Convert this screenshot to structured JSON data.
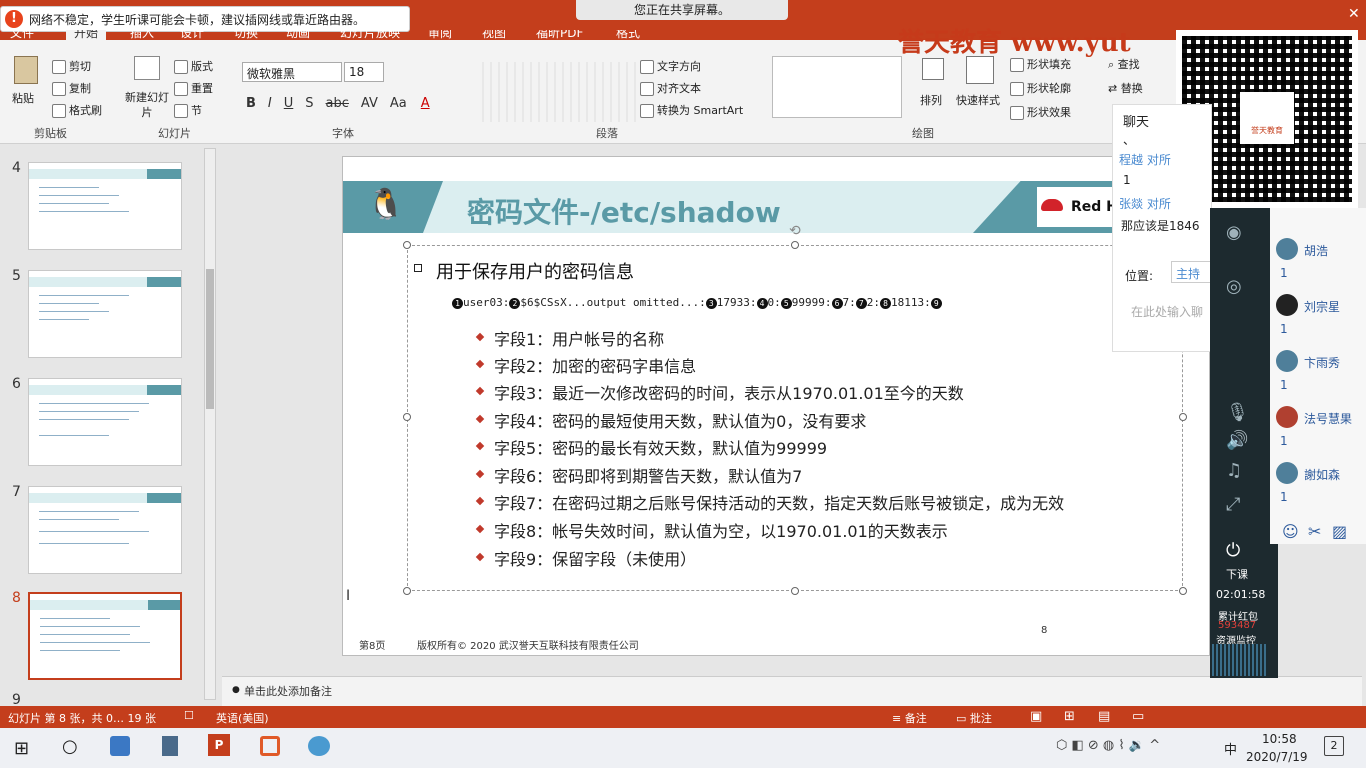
{
  "notification": {
    "text": "网络不稳定，学生听课可能会卡顿，建议插网线或靠近路由器。"
  },
  "share_banner": "您正在共享屏幕。",
  "brand": "誉天教育 www.yut",
  "ribbon": {
    "tabs": [
      "文件",
      "开始",
      "插入",
      "设计",
      "切换",
      "动画",
      "幻灯片放映",
      "审阅",
      "视图",
      "福昕PDF",
      "格式"
    ],
    "clipboard": {
      "paste": "粘贴",
      "cut": "剪切",
      "copy": "复制",
      "format_painter": "格式刷",
      "label": "剪贴板"
    },
    "slides": {
      "new_slide": "新建幻灯片",
      "layout": "版式",
      "reset": "重置",
      "section": "节",
      "label": "幻灯片"
    },
    "font": {
      "name": "微软雅黑",
      "size": "18",
      "label": "字体"
    },
    "paragraph": {
      "text_direction": "文字方向",
      "align_text": "对齐文本",
      "smartart": "转换为 SmartArt",
      "label": "段落"
    },
    "drawing": {
      "arrange": "排列",
      "quick_styles": "快速样式",
      "shape_fill": "形状填充",
      "shape_outline": "形状轮廓",
      "shape_effects": "形状效果",
      "label": "绘图"
    },
    "editing": {
      "find": "查找",
      "replace": "替换"
    }
  },
  "thumbnails": [
    "4",
    "5",
    "6",
    "7",
    "8",
    "9"
  ],
  "slide": {
    "title": "密码文件-/etc/shadow",
    "redhat": "Red H",
    "heading": "用于保存用户的密码信息",
    "sample": {
      "parts": [
        "user03:",
        "$6$CSsX...output omitted...:",
        "17933:",
        "0:",
        "99999:",
        "7:",
        "2:",
        "18113:"
      ],
      "markers": [
        "1",
        "2",
        "3",
        "4",
        "5",
        "6",
        "7",
        "8",
        "9"
      ]
    },
    "fields": [
      "字段1：用户帐号的名称",
      "字段2：加密的密码字串信息",
      "字段3：最近一次修改密码的时间，表示从1970.01.01至今的天数",
      "字段4：密码的最短使用天数，默认值为0，没有要求",
      "字段5：密码的最长有效天数，默认值为99999",
      "字段6：密码即将到期警告天数，默认值为7",
      "字段7：在密码过期之后账号保持活动的天数，指定天数后账号被锁定，成为无效",
      "字段8：帐号失效时间，默认值为空，以1970.01.01的天数表示",
      "字段9：保留字段（未使用）"
    ],
    "footer_page": "第8页",
    "footer_copyright": "版权所有© 2020 武汉誉天互联科技有限责任公司",
    "page_number": "8"
  },
  "notes_placeholder": "单击此处添加备注",
  "status": {
    "slide_info": "幻灯片 第 8 张，共 0… 19 张",
    "language": "英语(美国)",
    "notes": "备注",
    "comments": "批注"
  },
  "chat": {
    "title": "聊天",
    "lines": [
      "、",
      "程越 对所",
      "1",
      "张燚 对所",
      "那应该是1846"
    ],
    "position_label": "位置:",
    "position_value": "主持",
    "input_placeholder": "在此处输入聊"
  },
  "qr_caption": "誉天教育",
  "participants": [
    {
      "name": "胡浩",
      "count": "1"
    },
    {
      "name": "刘宗星",
      "count": "1"
    },
    {
      "name": "卞雨秀",
      "count": "1"
    },
    {
      "name": "法号慧果",
      "count": "1"
    },
    {
      "name": "謝如森",
      "count": "1"
    }
  ],
  "sidebar": {
    "leave": "下课",
    "timer": "02:01:58",
    "packet_label": "累计红包",
    "packet_value": "593487",
    "monitor": "资源监控"
  },
  "taskbar": {
    "time": "10:58",
    "date": "2020/7/19",
    "ime": "中",
    "notif_count": "2"
  }
}
